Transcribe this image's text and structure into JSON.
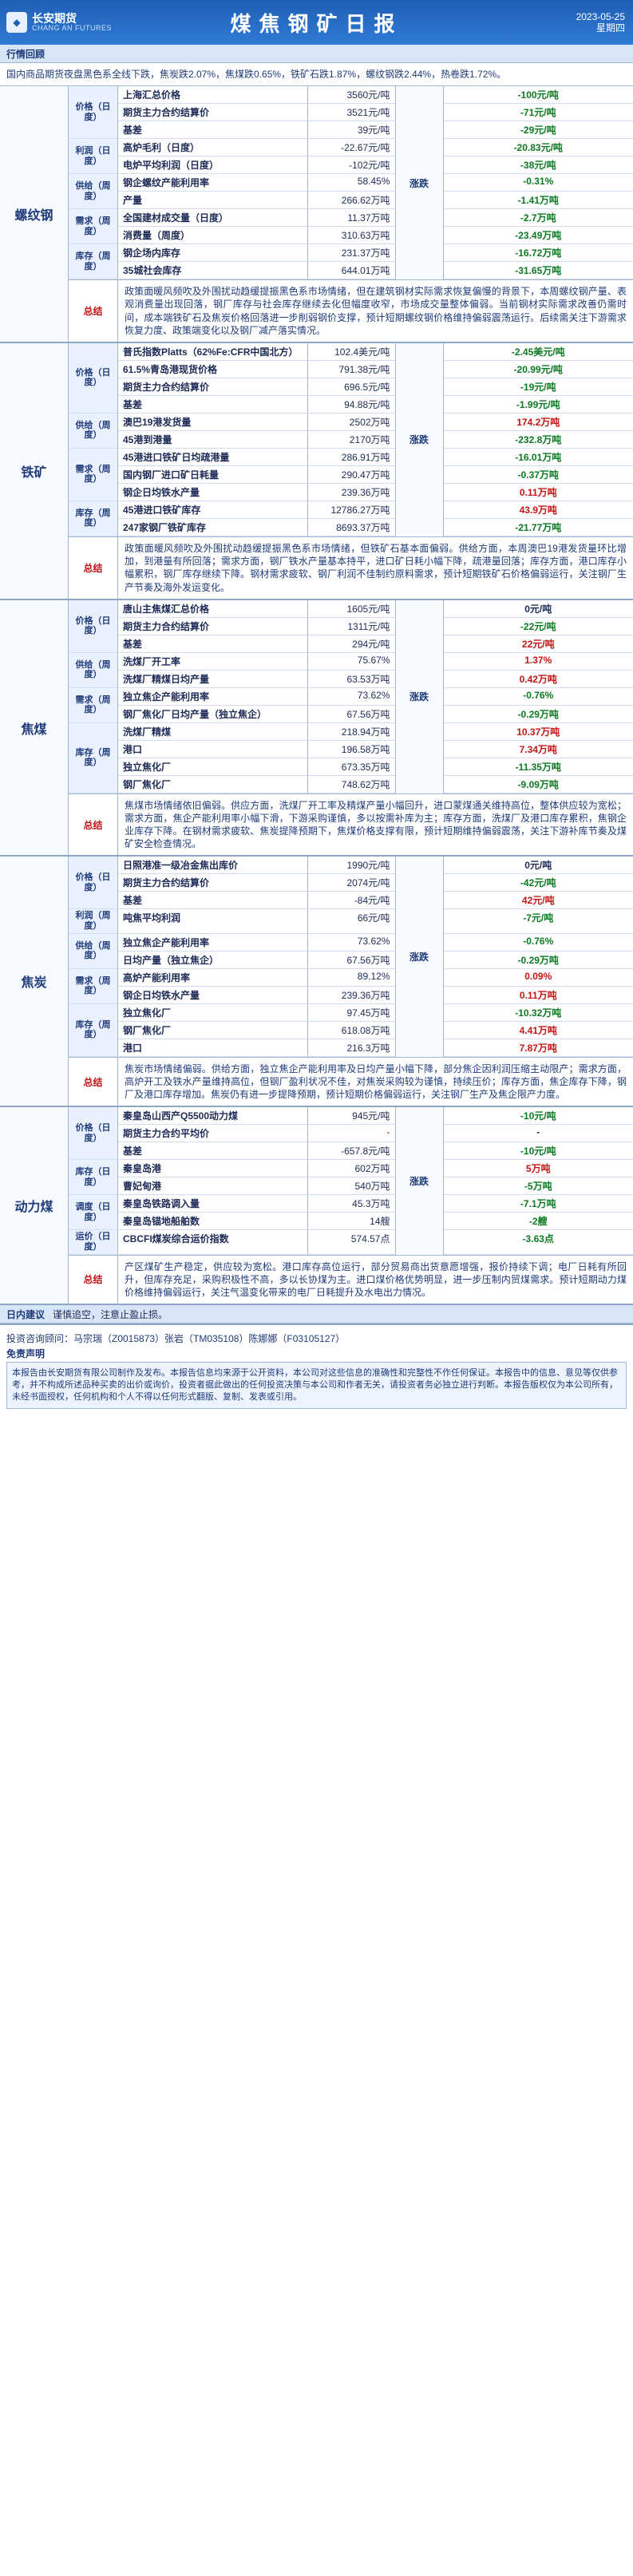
{
  "header": {
    "company_cn": "长安期货",
    "company_en": "CHANG AN FUTURES",
    "title": "煤焦钢矿日报",
    "date": "2023-05-25",
    "weekday": "星期四"
  },
  "review": {
    "label": "行情回顾",
    "text": "国内商品期货夜盘黑色系全线下跌，焦炭跌2.07%，焦煤跌0.65%，铁矿石跌1.87%，螺纹钢跌2.44%，热卷跌1.72%。"
  },
  "sections": [
    {
      "name": "螺纹钢",
      "trend": "涨跌",
      "groups": [
        {
          "category": "价格（日度）",
          "rows": [
            {
              "metric": "上海汇总价格",
              "value": "3560元/吨",
              "change": "-100元/吨",
              "dir": "down"
            },
            {
              "metric": "期货主力合约结算价",
              "value": "3521元/吨",
              "change": "-71元/吨",
              "dir": "down"
            },
            {
              "metric": "基差",
              "value": "39元/吨",
              "change": "-29元/吨",
              "dir": "down"
            }
          ]
        },
        {
          "category": "利润（日度）",
          "rows": [
            {
              "metric": "高炉毛利（日度）",
              "value": "-22.67元/吨",
              "change": "-20.83元/吨",
              "dir": "down"
            },
            {
              "metric": "电炉平均利润（日度）",
              "value": "-102元/吨",
              "change": "-38元/吨",
              "dir": "down"
            }
          ]
        },
        {
          "category": "供给（周度）",
          "rows": [
            {
              "metric": "钢企螺纹产能利用率",
              "value": "58.45%",
              "change": "-0.31%",
              "dir": "down"
            },
            {
              "metric": "产量",
              "value": "266.62万吨",
              "change": "-1.41万吨",
              "dir": "down"
            }
          ]
        },
        {
          "category": "需求（周度）",
          "rows": [
            {
              "metric": "全国建材成交量（日度）",
              "value": "11.37万吨",
              "change": "-2.7万吨",
              "dir": "down"
            },
            {
              "metric": "消费量（周度）",
              "value": "310.63万吨",
              "change": "-23.49万吨",
              "dir": "down"
            }
          ]
        },
        {
          "category": "库存（周度）",
          "rows": [
            {
              "metric": "钢企场内库存",
              "value": "231.37万吨",
              "change": "-16.72万吨",
              "dir": "down"
            },
            {
              "metric": "35城社会库存",
              "value": "644.01万吨",
              "change": "-31.65万吨",
              "dir": "down"
            }
          ]
        }
      ],
      "summary_label": "总结",
      "summary": "政策面暖风频吹及外围扰动趋缓提振黑色系市场情绪，但在建筑钢材实际需求恢复偏慢的背景下，本周螺纹钢产量、表观消费量出现回落，钢厂库存与社会库存继续去化但幅度收窄，市场成交量整体偏弱。当前钢材实际需求改善仍需时间，成本端铁矿石及焦炭价格回落进一步削弱钢价支撑，预计短期螺纹钢价格维持偏弱震荡运行。后续需关注下游需求恢复力度、政策端变化以及钢厂减产落实情况。"
    },
    {
      "name": "铁矿",
      "trend": "涨跌",
      "groups": [
        {
          "category": "价格（日度）",
          "rows": [
            {
              "metric": "普氏指数Platts（62%Fe:CFR中国北方）",
              "value": "102.4美元/吨",
              "change": "-2.45美元/吨",
              "dir": "down"
            },
            {
              "metric": "61.5%青岛港现货价格",
              "value": "791.38元/吨",
              "change": "-20.99元/吨",
              "dir": "down"
            },
            {
              "metric": "期货主力合约结算价",
              "value": "696.5元/吨",
              "change": "-19元/吨",
              "dir": "down"
            },
            {
              "metric": "基差",
              "value": "94.88元/吨",
              "change": "-1.99元/吨",
              "dir": "down"
            }
          ]
        },
        {
          "category": "供给（周度）",
          "rows": [
            {
              "metric": "澳巴19港发货量",
              "value": "2502万吨",
              "change": "174.2万吨",
              "dir": "up"
            },
            {
              "metric": "45港到港量",
              "value": "2170万吨",
              "change": "-232.8万吨",
              "dir": "down"
            }
          ]
        },
        {
          "category": "需求（周度）",
          "rows": [
            {
              "metric": "45港进口铁矿日均疏港量",
              "value": "286.91万吨",
              "change": "-16.01万吨",
              "dir": "down"
            },
            {
              "metric": "国内钢厂进口矿日耗量",
              "value": "290.47万吨",
              "change": "-0.37万吨",
              "dir": "down"
            },
            {
              "metric": "钢企日均铁水产量",
              "value": "239.36万吨",
              "change": "0.11万吨",
              "dir": "up"
            }
          ]
        },
        {
          "category": "库存（周度）",
          "rows": [
            {
              "metric": "45港进口铁矿库存",
              "value": "12786.27万吨",
              "change": "43.9万吨",
              "dir": "up"
            },
            {
              "metric": "247家钢厂铁矿库存",
              "value": "8693.37万吨",
              "change": "-21.77万吨",
              "dir": "down"
            }
          ]
        }
      ],
      "summary_label": "总结",
      "summary": "政策面暖风频吹及外围扰动趋缓提振黑色系市场情绪，但铁矿石基本面偏弱。供给方面，本周澳巴19港发货量环比增加，到港量有所回落；需求方面，钢厂铁水产量基本持平，进口矿日耗小幅下降，疏港量回落；库存方面，港口库存小幅累积，钢厂库存继续下降。钢材需求疲软、钢厂利润不佳制约原料需求，预计短期铁矿石价格偏弱运行，关注钢厂生产节奏及海外发运变化。"
    },
    {
      "name": "焦煤",
      "trend": "涨跌",
      "groups": [
        {
          "category": "价格（日度）",
          "rows": [
            {
              "metric": "唐山主焦煤汇总价格",
              "value": "1605元/吨",
              "change": "0元/吨",
              "dir": "flat"
            },
            {
              "metric": "期货主力合约结算价",
              "value": "1311元/吨",
              "change": "-22元/吨",
              "dir": "down"
            },
            {
              "metric": "基差",
              "value": "294元/吨",
              "change": "22元/吨",
              "dir": "up"
            }
          ]
        },
        {
          "category": "供给（周度）",
          "rows": [
            {
              "metric": "洗煤厂开工率",
              "value": "75.67%",
              "change": "1.37%",
              "dir": "up"
            },
            {
              "metric": "洗煤厂精煤日均产量",
              "value": "63.53万吨",
              "change": "0.42万吨",
              "dir": "up"
            }
          ]
        },
        {
          "category": "需求（周度）",
          "rows": [
            {
              "metric": "独立焦企产能利用率",
              "value": "73.62%",
              "change": "-0.76%",
              "dir": "down"
            },
            {
              "metric": "钢厂焦化厂日均产量（独立焦企）",
              "value": "67.56万吨",
              "change": "-0.29万吨",
              "dir": "down"
            }
          ]
        },
        {
          "category": "库存（周度）",
          "rows": [
            {
              "metric": "洗煤厂精煤",
              "value": "218.94万吨",
              "change": "10.37万吨",
              "dir": "up"
            },
            {
              "metric": "港口",
              "value": "196.58万吨",
              "change": "7.34万吨",
              "dir": "up"
            },
            {
              "metric": "独立焦化厂",
              "value": "673.35万吨",
              "change": "-11.35万吨",
              "dir": "down"
            },
            {
              "metric": "钢厂焦化厂",
              "value": "748.62万吨",
              "change": "-9.09万吨",
              "dir": "down"
            }
          ]
        }
      ],
      "summary_label": "总结",
      "summary": "焦煤市场情绪依旧偏弱。供应方面，洗煤厂开工率及精煤产量小幅回升，进口蒙煤通关维持高位，整体供应较为宽松；需求方面，焦企产能利用率小幅下滑，下游采购谨慎，多以按需补库为主；库存方面，洗煤厂及港口库存累积，焦钢企业库存下降。在钢材需求疲软、焦炭提降预期下，焦煤价格支撑有限，预计短期维持偏弱震荡，关注下游补库节奏及煤矿安全检查情况。"
    },
    {
      "name": "焦炭",
      "trend": "涨跌",
      "groups": [
        {
          "category": "价格（日度）",
          "rows": [
            {
              "metric": "日照港准一级冶金焦出库价",
              "value": "1990元/吨",
              "change": "0元/吨",
              "dir": "flat"
            },
            {
              "metric": "期货主力合约结算价",
              "value": "2074元/吨",
              "change": "-42元/吨",
              "dir": "down"
            },
            {
              "metric": "基差",
              "value": "-84元/吨",
              "change": "42元/吨",
              "dir": "up"
            }
          ]
        },
        {
          "category": "利润（周度）",
          "rows": [
            {
              "metric": "吨焦平均利润",
              "value": "66元/吨",
              "change": "-7元/吨",
              "dir": "down"
            }
          ]
        },
        {
          "category": "供给（周度）",
          "rows": [
            {
              "metric": "独立焦企产能利用率",
              "value": "73.62%",
              "change": "-0.76%",
              "dir": "down"
            },
            {
              "metric": "日均产量（独立焦企）",
              "value": "67.56万吨",
              "change": "-0.29万吨",
              "dir": "down"
            }
          ]
        },
        {
          "category": "需求（周度）",
          "rows": [
            {
              "metric": "高炉产能利用率",
              "value": "89.12%",
              "change": "0.09%",
              "dir": "up"
            },
            {
              "metric": "钢企日均铁水产量",
              "value": "239.36万吨",
              "change": "0.11万吨",
              "dir": "up"
            }
          ]
        },
        {
          "category": "库存（周度）",
          "rows": [
            {
              "metric": "独立焦化厂",
              "value": "97.45万吨",
              "change": "-10.32万吨",
              "dir": "down"
            },
            {
              "metric": "钢厂焦化厂",
              "value": "618.08万吨",
              "change": "4.41万吨",
              "dir": "up"
            },
            {
              "metric": "港口",
              "value": "216.3万吨",
              "change": "7.87万吨",
              "dir": "up"
            }
          ]
        }
      ],
      "summary_label": "总结",
      "summary": "焦炭市场情绪偏弱。供给方面，独立焦企产能利用率及日均产量小幅下降，部分焦企因利润压缩主动限产；需求方面，高炉开工及铁水产量维持高位，但钢厂盈利状况不佳，对焦炭采购较为谨慎，持续压价；库存方面，焦企库存下降，钢厂及港口库存增加。焦炭仍有进一步提降预期，预计短期价格偏弱运行，关注钢厂生产及焦企限产力度。"
    },
    {
      "name": "动力煤",
      "trend": "涨跌",
      "groups": [
        {
          "category": "价格（日度）",
          "rows": [
            {
              "metric": "秦皇岛山西产Q5500动力煤",
              "value": "945元/吨",
              "change": "-10元/吨",
              "dir": "down"
            },
            {
              "metric": "期货主力合约平均价",
              "value": "-",
              "change": "-",
              "dir": "flat"
            },
            {
              "metric": "基差",
              "value": "-657.8元/吨",
              "change": "-10元/吨",
              "dir": "down"
            }
          ]
        },
        {
          "category": "库存（日度）",
          "rows": [
            {
              "metric": "秦皇岛港",
              "value": "602万吨",
              "change": "5万吨",
              "dir": "up"
            },
            {
              "metric": "曹妃甸港",
              "value": "540万吨",
              "change": "-5万吨",
              "dir": "down"
            }
          ]
        },
        {
          "category": "调度（日度）",
          "rows": [
            {
              "metric": "秦皇岛铁路调入量",
              "value": "45.3万吨",
              "change": "-7.1万吨",
              "dir": "down"
            },
            {
              "metric": "秦皇岛锚地船舶数",
              "value": "14艘",
              "change": "-2艘",
              "dir": "down"
            }
          ]
        },
        {
          "category": "运价（日度）",
          "rows": [
            {
              "metric": "CBCFI煤炭综合运价指数",
              "value": "574.57点",
              "change": "-3.63点",
              "dir": "down"
            }
          ]
        }
      ],
      "summary_label": "总结",
      "summary": "产区煤矿生产稳定，供应较为宽松。港口库存高位运行，部分贸易商出货意愿增强，报价持续下调；电厂日耗有所回升，但库存充足，采购积极性不高，多以长协煤为主。进口煤价格优势明显，进一步压制内贸煤需求。预计短期动力煤价格维持偏弱运行，关注气温变化带来的电厂日耗提升及水电出力情况。"
    }
  ],
  "tip": {
    "label": "日内建议",
    "text": "谨慎追空，注意止盈止损。"
  },
  "footer": {
    "investment_advisors": "投资咨询顾问：马宗瑞（Z0015873）张岩（TM035108）陈娜娜（F03105127）",
    "disclaimer_title": "免责声明",
    "disclaimer": "本报告由长安期货有限公司制作及发布。本报告信息均来源于公开资料，本公司对这些信息的准确性和完整性不作任何保证。本报告中的信息、意见等仅供参考，并不构成所述品种买卖的出价或询价，投资者据此做出的任何投资决策与本公司和作者无关，请投资者务必独立进行判断。本报告版权仅为本公司所有，未经书面授权，任何机构和个人不得以任何形式翻版、复制、发表或引用。"
  }
}
